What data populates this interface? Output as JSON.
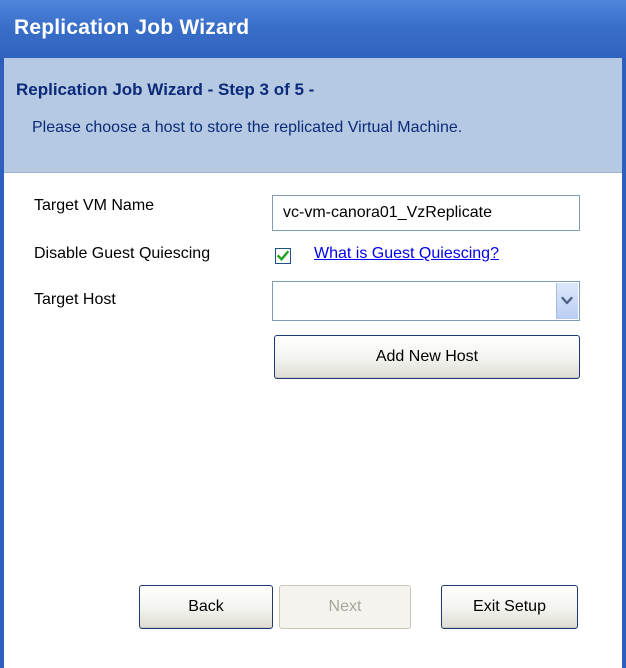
{
  "window": {
    "title": "Replication Job Wizard"
  },
  "header": {
    "step_title": "Replication Job Wizard - Step 3 of 5 -",
    "description": "Please choose a host to store the replicated Virtual Machine."
  },
  "form": {
    "target_vm_name": {
      "label": "Target VM Name",
      "value": "vc-vm-canora01_VzReplicate"
    },
    "disable_guest_quiescing": {
      "label": "Disable Guest Quiescing",
      "checked": true,
      "help_link": "What is Guest Quiescing?"
    },
    "target_host": {
      "label": "Target Host",
      "selected": "",
      "add_button": "Add New Host"
    }
  },
  "footer": {
    "back_label": "Back",
    "next_label": "Next",
    "exit_label": "Exit Setup"
  },
  "icons": {
    "checkbox": "checkmark-icon",
    "dropdown": "chevron-down-icon"
  },
  "colors": {
    "titlebar": "#3a6fc9",
    "header_band": "#b6c9e3",
    "header_text": "#0b2a7a",
    "link": "#0000ee",
    "checkmark": "#21a121"
  }
}
